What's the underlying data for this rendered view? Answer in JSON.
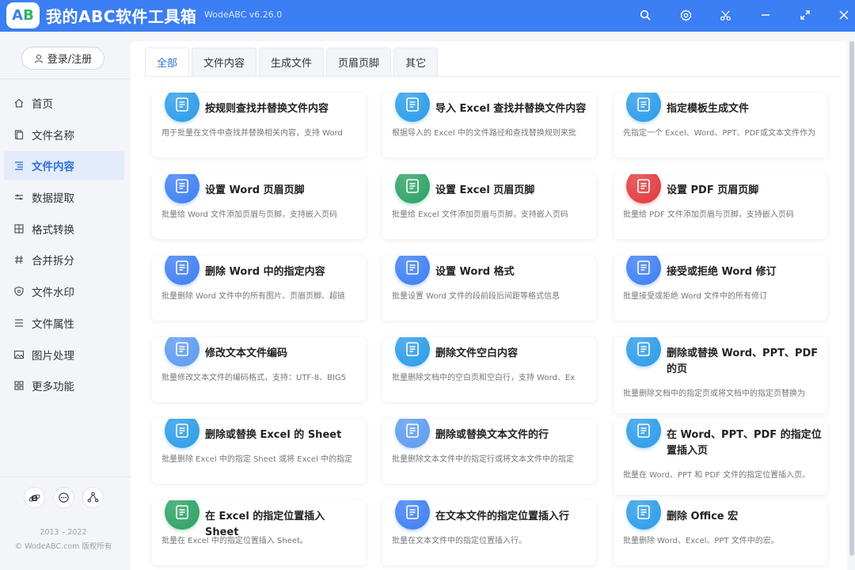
{
  "app": {
    "title": "我的ABC软件工具箱",
    "version": "WodeABC v6.26.0",
    "logo_a": "A",
    "logo_b": "B"
  },
  "titlebar_icons": [
    "search-icon",
    "settings-icon",
    "scissors-icon",
    "minimize-icon",
    "maximize-icon",
    "close-icon"
  ],
  "sidebar": {
    "login_label": "登录/注册",
    "items": [
      {
        "label": "首页",
        "icon": "home-icon",
        "active": false
      },
      {
        "label": "文件名称",
        "icon": "file-icon",
        "active": false
      },
      {
        "label": "文件内容",
        "icon": "list-icon",
        "active": true
      },
      {
        "label": "数据提取",
        "icon": "extract-icon",
        "active": false
      },
      {
        "label": "格式转换",
        "icon": "convert-icon",
        "active": false
      },
      {
        "label": "合并拆分",
        "icon": "hash-icon",
        "active": false
      },
      {
        "label": "文件水印",
        "icon": "shield-icon",
        "active": false
      },
      {
        "label": "文件属性",
        "icon": "properties-icon",
        "active": false
      },
      {
        "label": "图片处理",
        "icon": "image-icon",
        "active": false
      },
      {
        "label": "更多功能",
        "icon": "grid-icon",
        "active": false
      }
    ],
    "footer_icons": [
      "browser-icon",
      "chat-icon",
      "share-icon"
    ],
    "years": "2013 – 2022",
    "copyright": "© WodeABC.com 版权所有"
  },
  "tabs": [
    {
      "label": "全部",
      "active": true
    },
    {
      "label": "文件内容",
      "active": false
    },
    {
      "label": "生成文件",
      "active": false
    },
    {
      "label": "页眉页脚",
      "active": false
    },
    {
      "label": "其它",
      "active": false
    }
  ],
  "cards": [
    {
      "title": "按规则查找并替换文件内容",
      "desc": "用于批量在文件中查找并替换相关内容，支持 Word",
      "icon": "edit-document-icon",
      "color": "#2a9be8"
    },
    {
      "title": "导入 Excel 查找并替换文件内容",
      "desc": "根据导入的 Excel 中的文件路径和查找替换规则来批",
      "icon": "excel-replace-icon",
      "color": "#2a9be8"
    },
    {
      "title": "指定模板生成文件",
      "desc": "先指定一个 Excel、Word、PPT、PDF或文本文件作为",
      "icon": "template-icon",
      "color": "#2a9be8"
    },
    {
      "title": "设置 Word 页眉页脚",
      "desc": "批量给 Word 文件添加页眉与页脚，支持嵌入页码",
      "icon": "word-header-icon",
      "color": "#3c7ef3"
    },
    {
      "title": "设置 Excel 页眉页脚",
      "desc": "批量给 Excel 文件添加页眉与页脚，支持嵌入页码",
      "icon": "excel-header-icon",
      "color": "#2aa163"
    },
    {
      "title": "设置 PDF 页眉页脚",
      "desc": "批量给 PDF 文件添加页眉与页脚，支持嵌入页码",
      "icon": "pdf-header-icon",
      "color": "#e0393b"
    },
    {
      "title": "删除 Word 中的指定内容",
      "desc": "批量删除 Word 文件中的所有图片、页眉页脚、超链",
      "icon": "word-delete-icon",
      "color": "#3c7ef3"
    },
    {
      "title": "设置 Word 格式",
      "desc": "批量设置 Word 文件的段前段后间距等格式信息",
      "icon": "word-format-icon",
      "color": "#3c7ef3"
    },
    {
      "title": "接受或拒绝 Word 修订",
      "desc": "批量接受或拒绝 Word 文件中的所有修订",
      "icon": "word-revision-icon",
      "color": "#3c7ef3"
    },
    {
      "title": "修改文本文件编码",
      "desc": "批量修改文本文件的编码格式，支持：UTF-8、BIG5",
      "icon": "text-encoding-icon",
      "color": "#5b9af0"
    },
    {
      "title": "删除文件空白内容",
      "desc": "批量删除文档中的空白页和空白行，支持 Word、Ex",
      "icon": "blank-delete-icon",
      "color": "#2a9be8"
    },
    {
      "title": "删除或替换 Word、PPT、PDF 的页",
      "desc": "批量删除文档中的指定页或将文档中的指定页替换为",
      "icon": "page-replace-icon",
      "color": "#2a9be8",
      "tall": true
    },
    {
      "title": "删除或替换 Excel 的 Sheet",
      "desc": "批量删除 Excel 中的指定 Sheet 或将 Excel 中的指定",
      "icon": "sheet-replace-icon",
      "color": "#2a9be8"
    },
    {
      "title": "删除或替换文本文件的行",
      "desc": "批量删除文本文件中的指定行或将文本文件中的指定",
      "icon": "line-replace-icon",
      "color": "#5b9af0"
    },
    {
      "title": "在 Word、PPT、PDF 的指定位置插入页",
      "desc": "批量在 Word、PPT 和 PDF 文件的指定位置插入页。",
      "icon": "page-insert-icon",
      "color": "#2a9be8",
      "tall": true
    },
    {
      "title": "在 Excel 的指定位置插入 Sheet",
      "desc": "批量在 Excel 中的指定位置插入 Sheet。",
      "icon": "sheet-insert-icon",
      "color": "#2aa163"
    },
    {
      "title": "在文本文件的指定位置插入行",
      "desc": "批量在文本文件中的指定位置插入行。",
      "icon": "line-insert-icon",
      "color": "#3c7ef3"
    },
    {
      "title": "删除 Office 宏",
      "desc": "批量删除 Word、Excel、PPT 文件中的宏。",
      "icon": "vba-icon",
      "color": "#2a9be8"
    }
  ]
}
